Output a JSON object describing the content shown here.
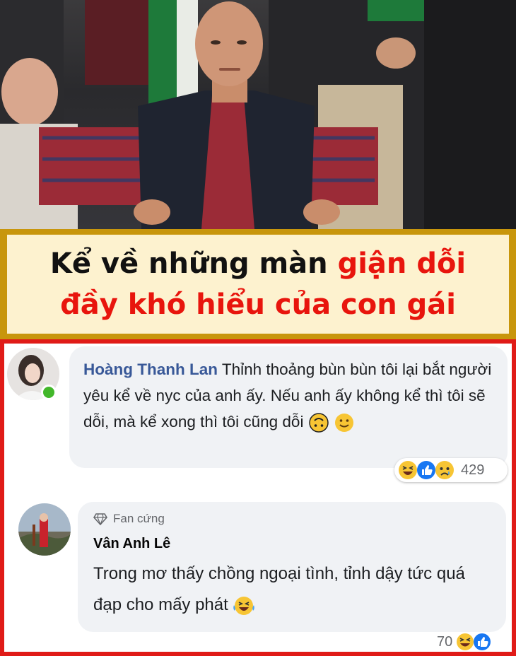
{
  "title": {
    "line1_prefix": "Kể về những màn ",
    "line1_highlight": "giận dỗi",
    "line2_highlight": "đầy khó hiểu của con gái",
    "text_color": "#111111",
    "highlight_color": "#e8150d",
    "banner_border_color": "#c8960c",
    "banner_bg_color": "#fdf2cf"
  },
  "frame_color": "#e01b17",
  "comments": [
    {
      "author": "Hoàng Thanh Lan",
      "text": "Thỉnh thoảng bùn bùn tôi lại bắt người yêu kể về nyc của anh ấy. Nếu anh ấy không kể thì tôi sẽ dỗi, mà kể xong thì tôi cũng dỗi",
      "inline_emojis": [
        "upside-down-face",
        "slightly-smiling-face"
      ],
      "online": true,
      "reactions": [
        "haha",
        "like",
        "sad"
      ],
      "reaction_count": "429"
    },
    {
      "badge_icon": "diamond-icon",
      "badge": "Fan cứng",
      "author": "Vân Anh Lê",
      "text": "Trong mơ thấy chồng ngoại tình, tỉnh dậy tức quá đạp cho mấy phát",
      "inline_emojis": [
        "tears-of-joy"
      ],
      "reactions": [
        "haha",
        "like"
      ],
      "reaction_count": "70"
    }
  ]
}
